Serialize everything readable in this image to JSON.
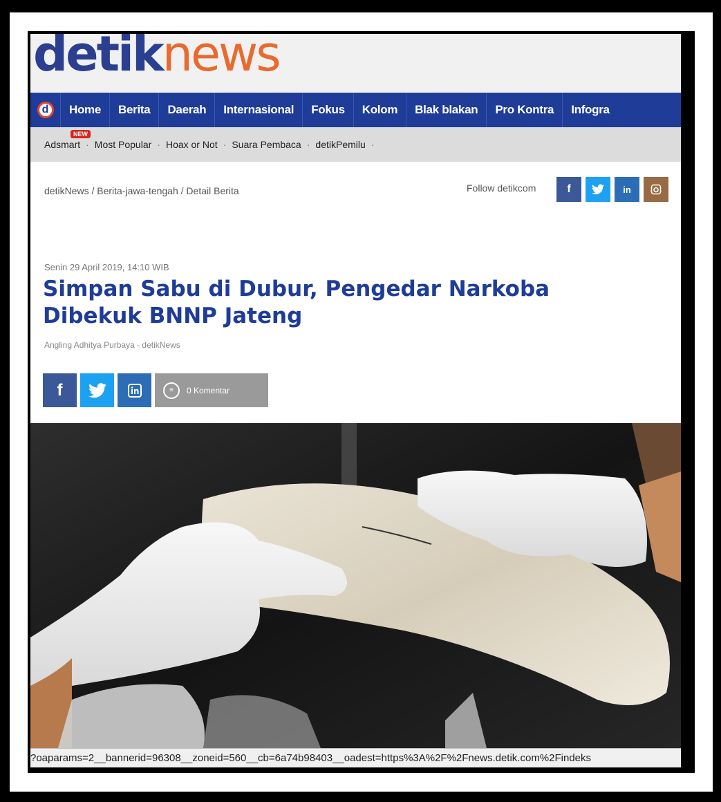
{
  "brand": {
    "logo_part1": "detik",
    "logo_part2": "news"
  },
  "nav": {
    "home_icon": "d",
    "items": [
      "Home",
      "Berita",
      "Daerah",
      "Internasional",
      "Fokus",
      "Kolom",
      "Blak blakan",
      "Pro Kontra",
      "Infogra"
    ]
  },
  "subnav": {
    "badge": "NEW",
    "items": [
      "Adsmart",
      "Most Popular",
      "Hoax or Not",
      "Suara Pembaca",
      "detikPemilu"
    ]
  },
  "breadcrumb": "detikNews / Berita-jawa-tengah / Detail Berita",
  "follow": {
    "label": "Follow detikcom",
    "icons": [
      "f",
      "t",
      "in",
      "ig"
    ]
  },
  "article": {
    "date": "Senin 29 April 2019, 14:10 WIB",
    "title": "Simpan Sabu di Dubur, Pengedar Narkoba Dibekuk BNNP Jateng",
    "author": "Angling Adhitya Purbaya - detikNews",
    "comment_label": "0 Komentar"
  },
  "colors": {
    "brand_blue": "#1e3c98",
    "brand_orange": "#e86a2f",
    "facebook": "#3b5998",
    "twitter": "#1da1f2",
    "linkedin": "#2d6db5",
    "instagram": "#9a6a43"
  },
  "status_url": "?oaparams=2__bannerid=96308__zoneid=560__cb=6a74b98403__oadest=https%3A%2F%2Fnews.detik.com%2Findeks"
}
